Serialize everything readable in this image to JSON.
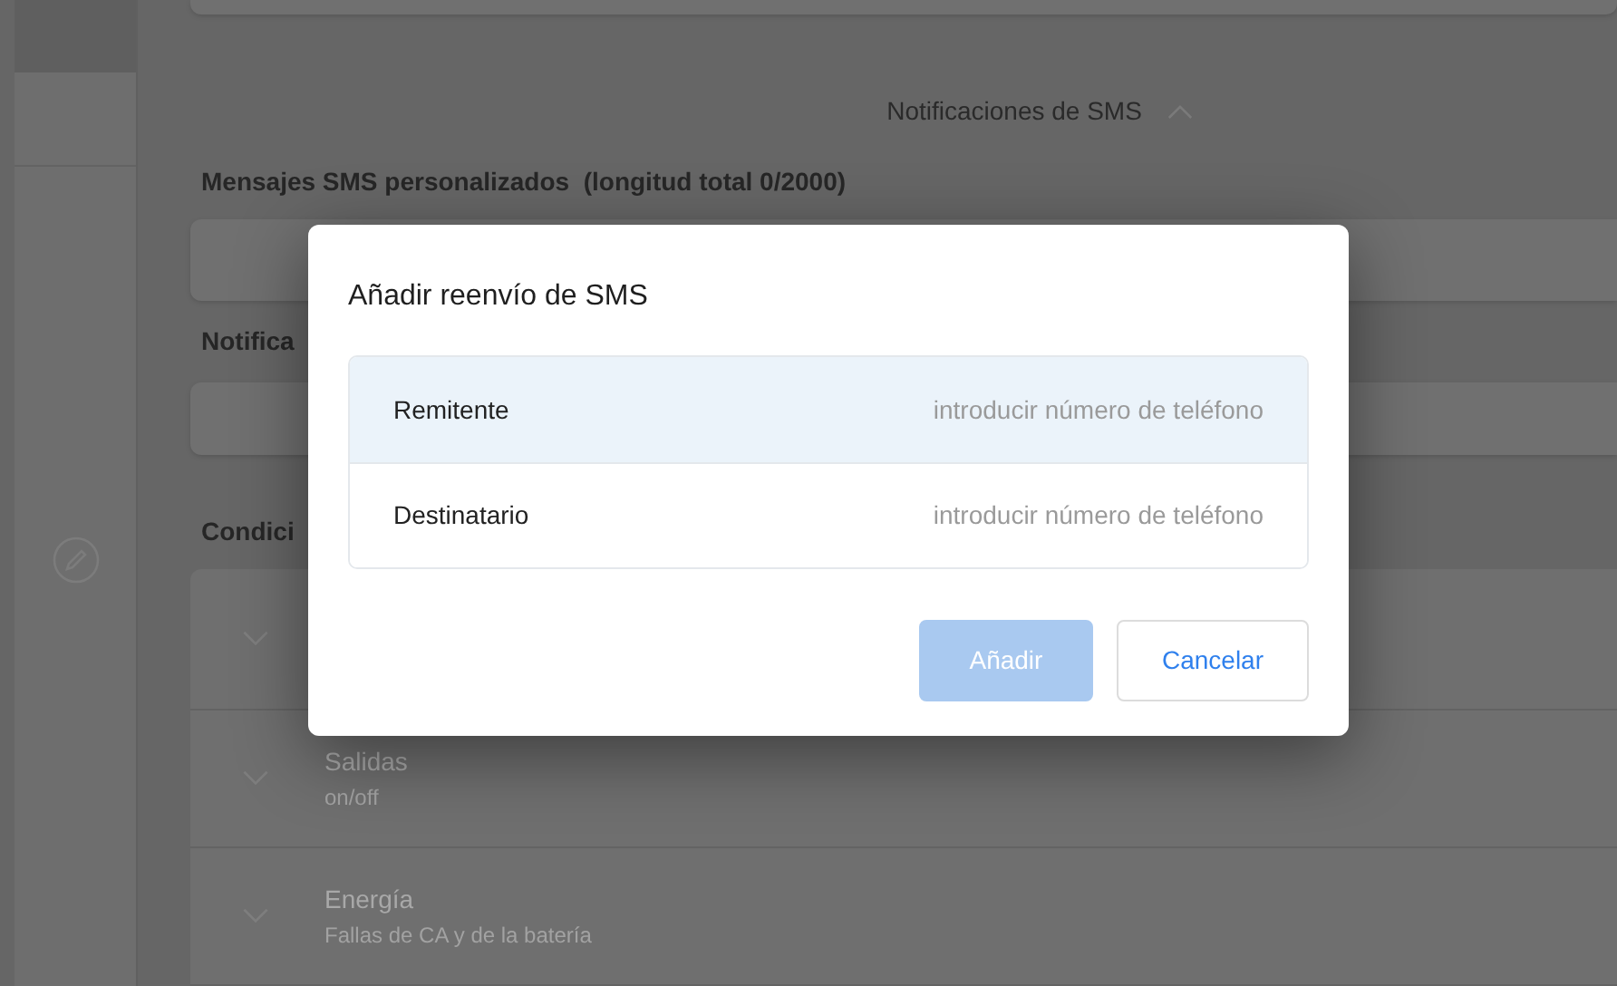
{
  "section": {
    "title": "Notificaciones de SMS",
    "expanded": true
  },
  "custom_messages": {
    "label": "Mensajes SMS personalizados  (longitud total 0/2000)"
  },
  "notifications": {
    "label": "Notifica"
  },
  "conditions": {
    "label": "Condici",
    "items": [
      {
        "title": "Salidas",
        "subtitle": "on/off"
      },
      {
        "title": "Energía",
        "subtitle": "Fallas de CA y de la batería"
      }
    ]
  },
  "dialog": {
    "title": "Añadir reenvío de SMS",
    "fields": [
      {
        "label": "Remitente",
        "placeholder": "introducir número de teléfono",
        "selected": true
      },
      {
        "label": "Destinatario",
        "placeholder": "introducir número de teléfono",
        "selected": false
      }
    ],
    "buttons": [
      {
        "label": "Añadir",
        "kind": "primary",
        "disabled": true
      },
      {
        "label": "Cancelar",
        "kind": "secondary",
        "disabled": false
      }
    ]
  }
}
